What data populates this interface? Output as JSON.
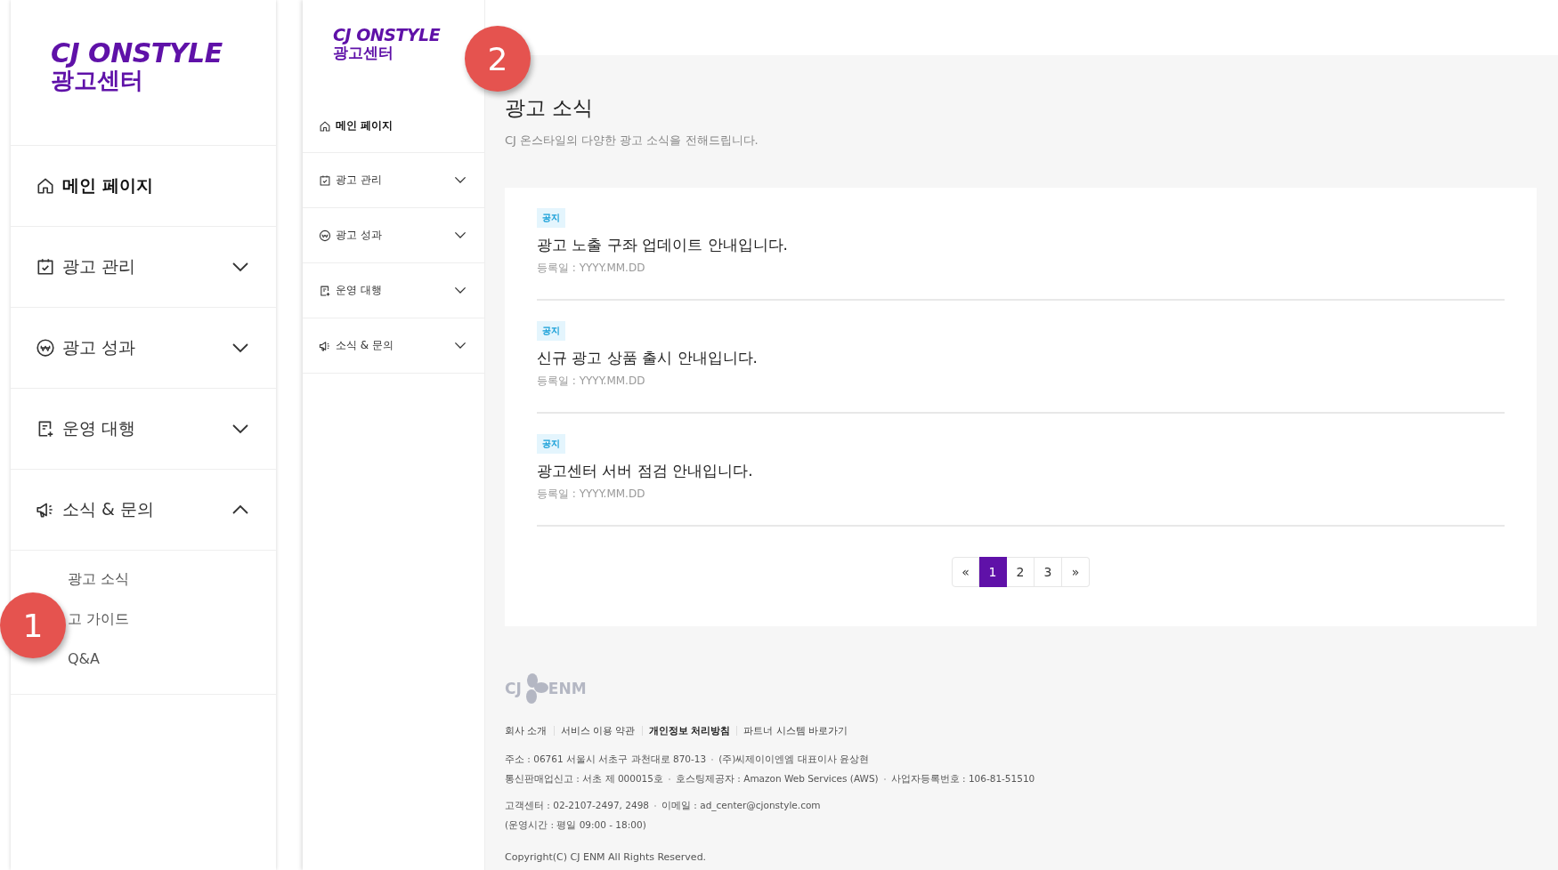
{
  "zoomed_sidebar": {
    "logo": {
      "brand": "CJ ONSTYLE",
      "sub": "광고센터"
    },
    "items": [
      {
        "kind": "link",
        "label": "메인 페이지"
      },
      {
        "kind": "group",
        "label": "광고 관리",
        "expanded": false
      },
      {
        "kind": "group",
        "label": "광고 성과",
        "expanded": false
      },
      {
        "kind": "group",
        "label": "운영 대행",
        "expanded": false
      },
      {
        "kind": "group",
        "label": "소식 & 문의",
        "expanded": true,
        "children": [
          "광고 소식",
          "고 가이드",
          "Q&A"
        ]
      }
    ]
  },
  "callouts": [
    "1",
    "2"
  ],
  "page": {
    "sidebar": {
      "logo": {
        "brand": "CJ ONSTYLE",
        "sub": "광고센터"
      },
      "items": [
        {
          "kind": "link",
          "label": "메인 페이지"
        },
        {
          "kind": "group",
          "label": "광고 관리",
          "expanded": false
        },
        {
          "kind": "group",
          "label": "광고 성과",
          "expanded": false
        },
        {
          "kind": "group",
          "label": "운영 대행",
          "expanded": false
        },
        {
          "kind": "group",
          "label": "소식 & 문의",
          "expanded": false
        }
      ]
    },
    "title": "광고 소식",
    "subtitle": "CJ 온스타일의 다양한 광고 소식을 전해드립니다.",
    "notices": [
      {
        "badge": "공지",
        "title": "광고 노출 구좌 업데이트 안내입니다.",
        "date": "등록일 : YYYY.MM.DD"
      },
      {
        "badge": "공지",
        "title": "신규 광고 상품 출시 안내입니다.",
        "date": "등록일 : YYYY.MM.DD"
      },
      {
        "badge": "공지",
        "title": "광고센터 서버 점검 안내입니다.",
        "date": "등록일 : YYYY.MM.DD"
      }
    ],
    "pagination": [
      {
        "label": "«",
        "selected": false
      },
      {
        "label": "1",
        "selected": true
      },
      {
        "label": "2",
        "selected": false
      },
      {
        "label": "3",
        "selected": false
      },
      {
        "label": "»",
        "selected": false
      }
    ],
    "footer": {
      "logo": {
        "left": "CJ",
        "right": "ENM"
      },
      "links": [
        {
          "label": "회사 소개",
          "bold": false
        },
        {
          "label": "서비스 이용 약관",
          "bold": false
        },
        {
          "label": "개인정보 처리방침",
          "bold": true
        },
        {
          "label": "파트너 시스템 바로가기",
          "bold": false
        }
      ],
      "info_lines": [
        [
          "주소 : 06761 서울시 서초구 과천대로 870-13",
          "(주)씨제이이엔엠 대표이사 윤상현"
        ],
        [
          "통신판매업신고 : 서초 제 000015호",
          "호스팅제공자 : Amazon Web Services (AWS)",
          "사업자등록번호 : 106-81-51510"
        ],
        [
          "고객센터 : 02-2107-2497, 2498",
          "이메일 : ad_center@cjonstyle.com"
        ],
        [
          "(운영시간 : 평일 09:00 - 18:00)"
        ]
      ],
      "copyright": "Copyright(C) CJ ENM All Rights Reserved."
    }
  }
}
